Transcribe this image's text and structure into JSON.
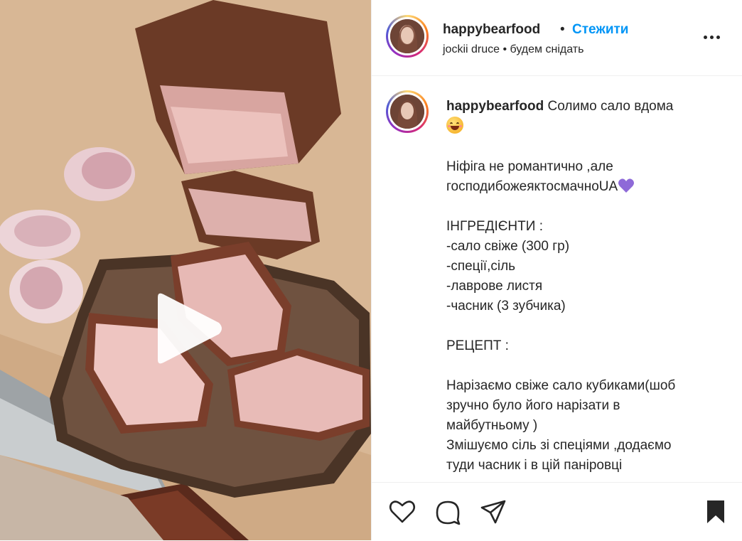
{
  "header": {
    "username": "happybearfood",
    "dot": "•",
    "follow_label": "Стежити",
    "subline": "jockii druce • будем снідать"
  },
  "caption": {
    "username": "happybearfood",
    "title": "Солимо сало вдома",
    "lines": [
      "",
      "Ніфіга не романтично ,але",
      "господибожеяктосмачноUA",
      "",
      "ІНГРЕДІЄНТИ :",
      "-сало свіже (300 гр)",
      "-спеції,сіль",
      "-лаврове листя",
      "-часник (3 зубчика)",
      "",
      "РЕЦЕПТ :",
      "",
      "Нарізаємо свіже сало кубиками(шоб",
      "зручно було його нарізати в",
      "майбутньому )",
      "Змішуємо сіль зі спеціями ,додаємо",
      "туди часник і в цій паніровці"
    ]
  },
  "icons": {
    "more": "more-horizontal-icon",
    "play": "play-icon",
    "like": "heart-outline-icon",
    "comment": "comment-icon",
    "share": "paper-plane-icon",
    "save": "bookmark-icon",
    "emoji1": "smiling-face-with-hearts-emoji",
    "emoji2": "purple-heart-emoji"
  },
  "colors": {
    "follow": "#0095f6",
    "text": "#262626",
    "divider": "#efefef"
  }
}
